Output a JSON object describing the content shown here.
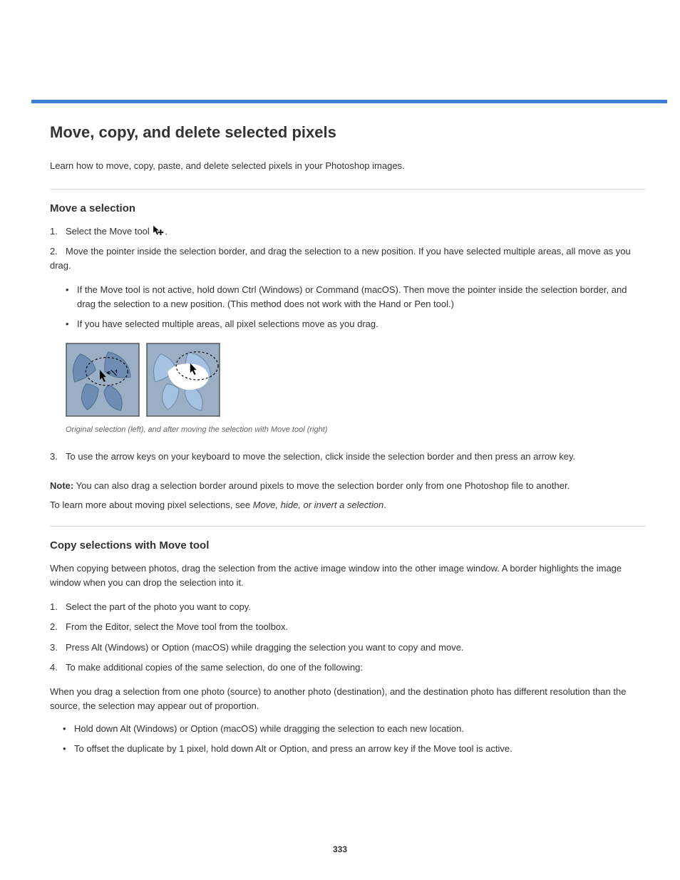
{
  "page_number": "333",
  "h1": "Move, copy, and delete selected pixels",
  "lead": "Learn how to move, copy, paste, and delete selected pixels in your Photoshop images.",
  "sec1": {
    "title": "Move a selection",
    "step1_a": "Select the Move tool ",
    "step1_b": ".",
    "step2": "Move the pointer inside the selection border, and drag the selection to a new position. If you have selected multiple areas, all move as you drag.",
    "bullets": [
      "If the Move tool is not active, hold down Ctrl (Windows) or Command (macOS). Then move the pointer inside the selection border, and drag the selection to a new position. (This method does not work with the Hand or Pen tool.)",
      "If you have selected multiple areas, all pixel selections move as you drag."
    ],
    "caption": "Original selection (left), and after moving the selection with Move tool (right)",
    "step3": "To use the arrow keys on your keyboard to move the selection, click inside the selection border and then press an arrow key."
  },
  "notes": {
    "n1_label": "Note:",
    "n1": "You can also drag a selection border around pixels to move the selection border only from one Photoshop file to another.",
    "n2_prefix": "To learn more about moving pixel selections, see ",
    "n2_link": "Move, hide, or invert a selection"
  },
  "sec2": {
    "title": "Copy selections with Move tool",
    "intro": "When copying between photos, drag the selection from the active image window into the other image window. A border highlights the image window when you can drop the selection into it.",
    "step1": "Select the part of the photo you want to copy.",
    "step2": "From the Editor, select the Move tool from the toolbox.",
    "step3": "Press Alt (Windows) or Option (macOS) while dragging the selection you want to copy and move.",
    "step4_lead": "To make additional copies of the same selection, do one of the following:",
    "note": "When you drag a selection from one photo (source) to another photo (destination), and the destination photo has different resolution than the source, the selection may appear out of proportion.",
    "sub": [
      "Hold down Alt (Windows) or Option (macOS) while dragging the selection to each new location.",
      "To offset the duplicate by 1 pixel, hold down Alt or Option, and press an arrow key if the Move tool is active."
    ]
  }
}
